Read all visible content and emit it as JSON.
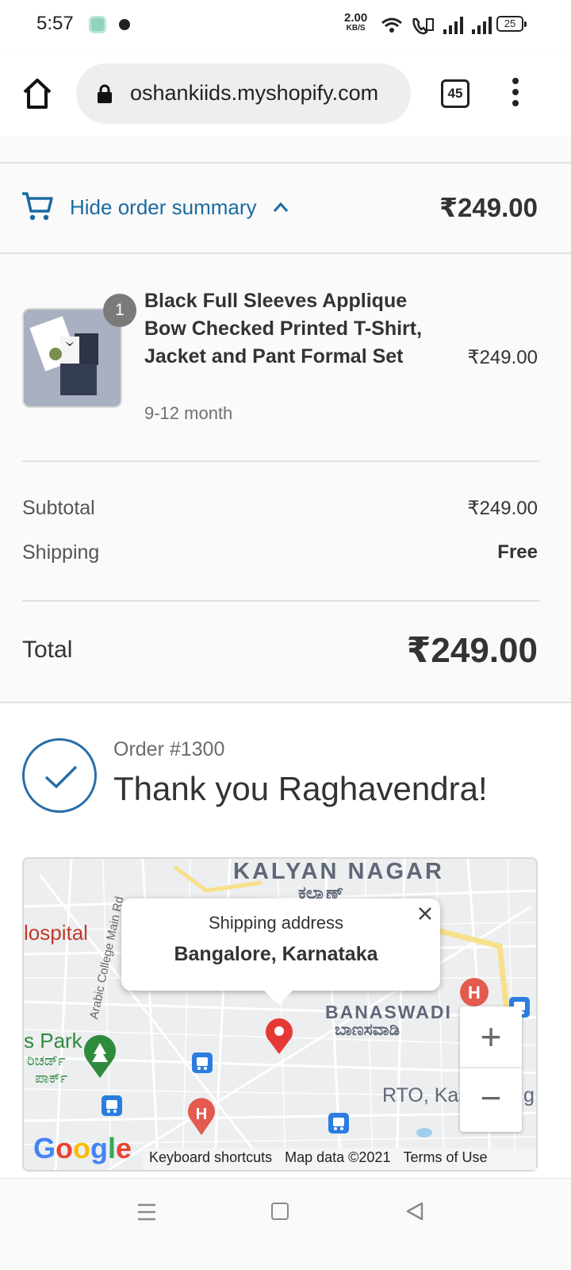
{
  "status_bar": {
    "time": "5:57",
    "speed_value": "2.00",
    "speed_unit": "KB/S",
    "battery": "25"
  },
  "browser": {
    "url": "oshankiids.myshopify.com",
    "tab_count": "45"
  },
  "order_summary": {
    "toggle_label": "Hide order summary",
    "header_total": "₹249.00",
    "item": {
      "quantity": "1",
      "name": "Black Full Sleeves Applique Bow Checked Printed T-Shirt, Jacket and Pant Formal Set",
      "variant": "9-12 month",
      "price": "₹249.00"
    },
    "subtotal_label": "Subtotal",
    "subtotal_value": "₹249.00",
    "shipping_label": "Shipping",
    "shipping_value": "Free",
    "total_label": "Total",
    "total_value": "₹249.00"
  },
  "confirmation": {
    "order_number": "Order #1300",
    "thank_you": "Thank you Raghavendra!"
  },
  "map": {
    "popup_title": "Shipping address",
    "popup_value": "Bangalore, Karnataka",
    "labels": {
      "kalyan_nagar": "KALYAN NAGAR",
      "kalyan_nagar_kn": "ಕಲ್ಯಾಣ್",
      "hospital": "lospital",
      "road": "Arabic College Main Rd",
      "banaswadi": "BANASWADI",
      "banaswadi_kn": "ಬಾಣಸವಾಡಿ",
      "park": "s Park",
      "park_kn1": "ರಿಚರ್ಡ್",
      "park_kn2": "ಪಾರ್ಕ್",
      "rto": "RTO, Kas",
      "rto_end": "g"
    },
    "zoom_in": "+",
    "zoom_out": "−",
    "footer": {
      "shortcuts": "Keyboard shortcuts",
      "map_data": "Map data ©2021",
      "terms": "Terms of Use"
    },
    "logo": "Google"
  },
  "colors": {
    "accent_blue": "#1a6aa0",
    "map_pin": "#e53935",
    "park_green": "#2e8b3e"
  }
}
